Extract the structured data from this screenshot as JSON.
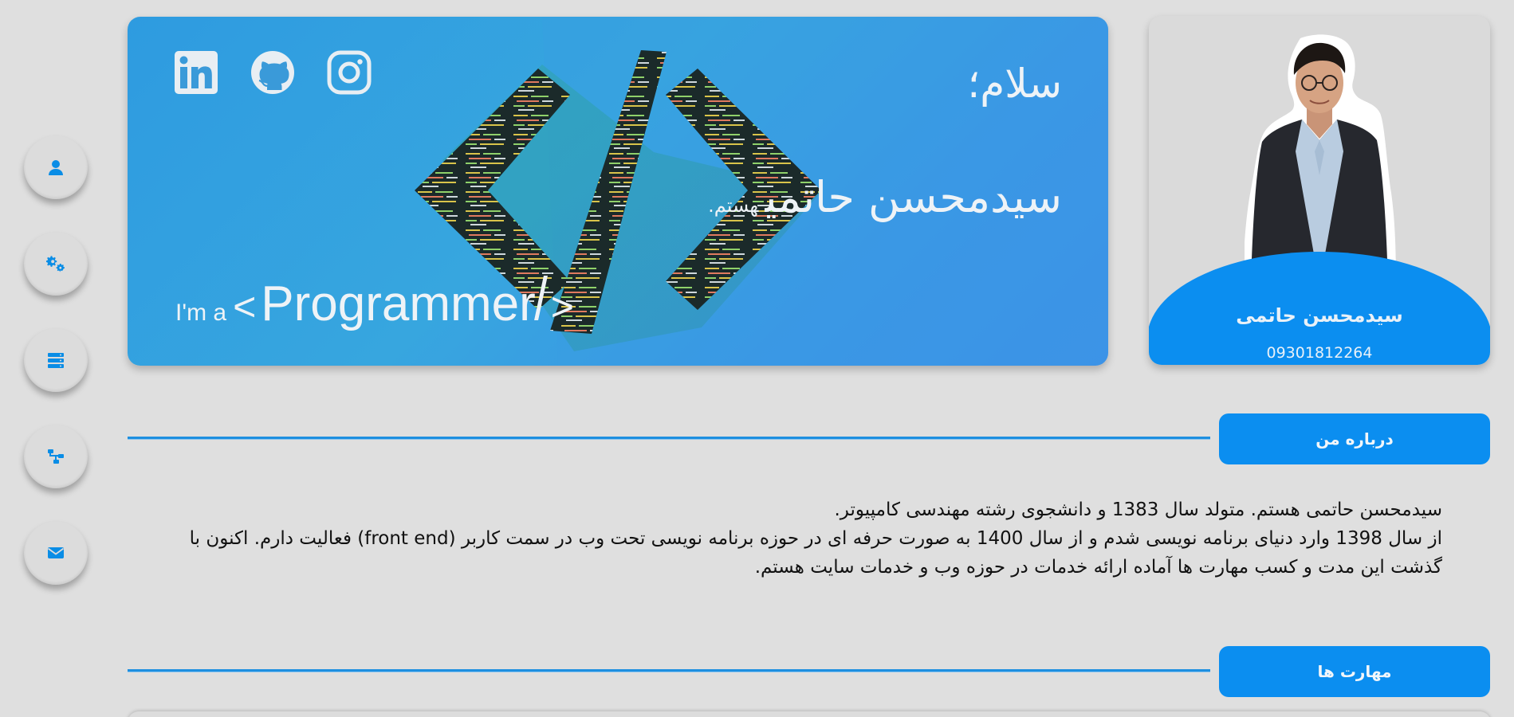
{
  "nav": {
    "items": [
      {
        "name": "profile",
        "icon": "user-icon"
      },
      {
        "name": "services",
        "icon": "gears-icon"
      },
      {
        "name": "resume",
        "icon": "server-icon"
      },
      {
        "name": "portfolio",
        "icon": "sitemap-icon"
      },
      {
        "name": "contact",
        "icon": "envelope-icon"
      }
    ]
  },
  "hero": {
    "greeting": "سلام؛",
    "name": "سیدمحسن حاتمی",
    "name_suffix": "هستم.",
    "role_prefix": "I'm a",
    "role_open": "<",
    "role_word": "Programmer",
    "role_close": ">",
    "social": [
      "linkedin-icon",
      "github-icon",
      "instagram-icon"
    ]
  },
  "profile": {
    "name": "سیدمحسن حاتمی",
    "phone": "09301812264"
  },
  "sections": {
    "about_title": "درباره من",
    "skills_title": "مهارت ها"
  },
  "about": {
    "line1": "سیدمحسن حاتمی هستم. متولد سال 1383 و دانشجوی رشته مهندسی کامپیوتر.",
    "line2": "از سال 1398 وارد دنیای برنامه نویسی شدم و از سال 1400 به صورت حرفه ای در حوزه برنامه نویسی تحت وب در سمت کاربر (front end) فعالیت دارم. اکنون با گذشت این مدت و کسب مهارت ها آماده ارائه خدمات در حوزه وب و خدمات سایت هستم."
  },
  "colors": {
    "accent": "#0b8ef0",
    "page_bg": "#dfdfdf",
    "hero_blue": "#37a6df"
  }
}
